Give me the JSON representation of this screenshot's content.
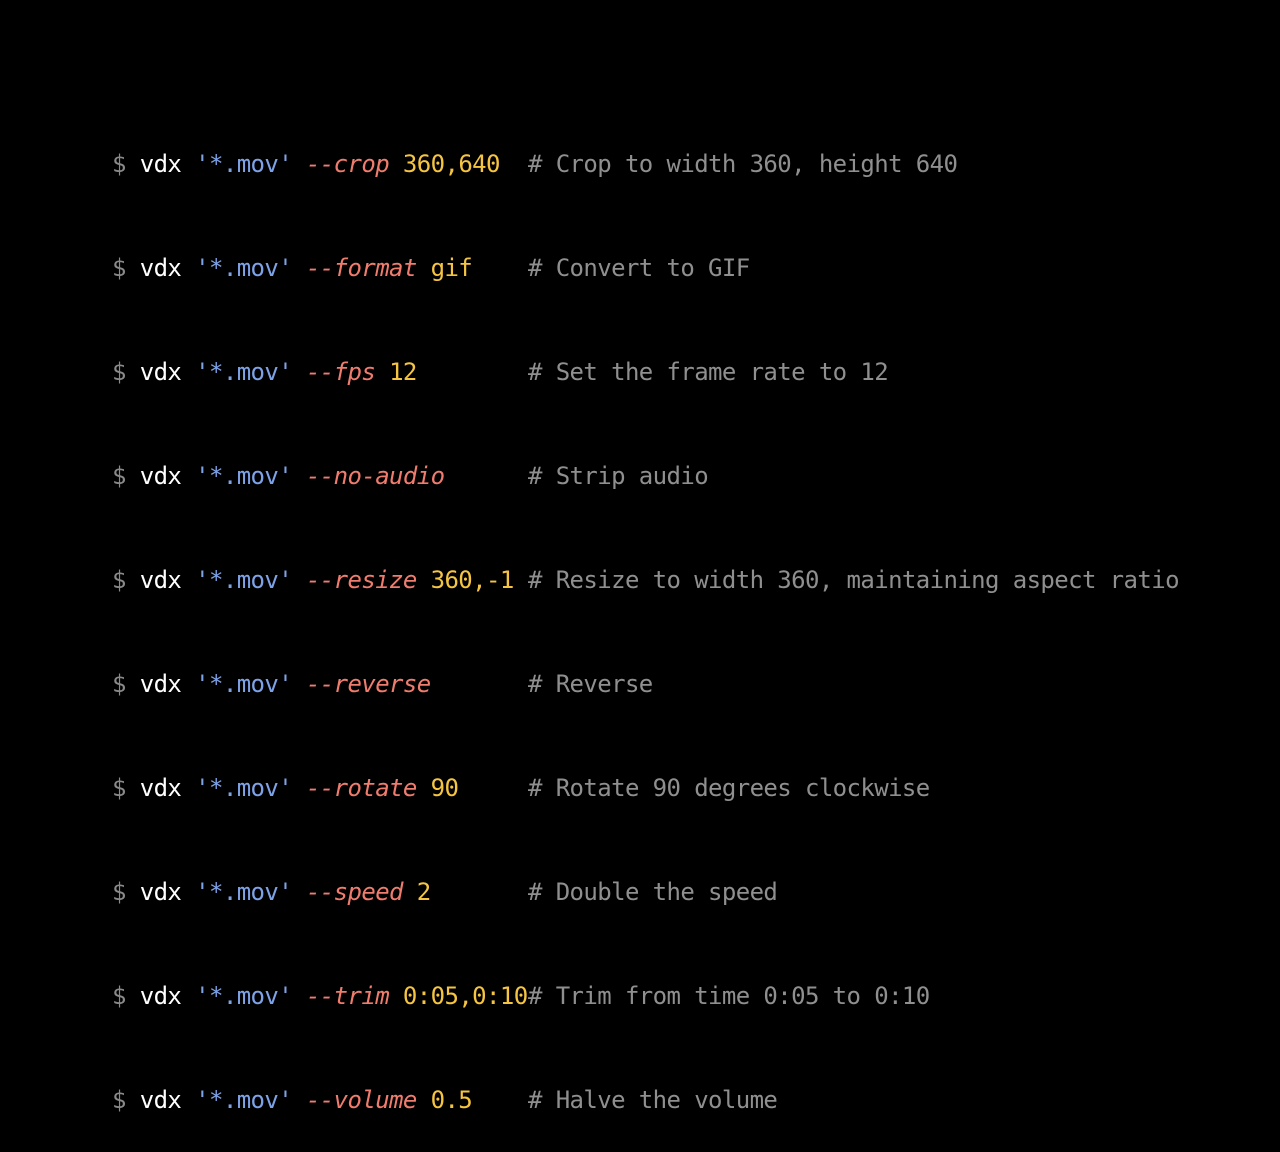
{
  "prompt_symbol": "$",
  "command": "vdx",
  "glob": "'*.mov'",
  "lines": [
    {
      "flag": "--crop",
      "arg": "360,640",
      "comment": "# Crop to width 360, height 640"
    },
    {
      "flag": "--format",
      "arg": "gif",
      "comment": "# Convert to GIF"
    },
    {
      "flag": "--fps",
      "arg": "12",
      "comment": "# Set the frame rate to 12"
    },
    {
      "flag": "--no-audio",
      "arg": "",
      "comment": "# Strip audio"
    },
    {
      "flag": "--resize",
      "arg": "360,-1",
      "comment": "# Resize to width 360, maintaining aspect ratio"
    },
    {
      "flag": "--reverse",
      "arg": "",
      "comment": "# Reverse"
    },
    {
      "flag": "--rotate",
      "arg": "90",
      "comment": "# Rotate 90 degrees clockwise"
    },
    {
      "flag": "--speed",
      "arg": "2",
      "comment": "# Double the speed"
    },
    {
      "flag": "--trim",
      "arg": "0:05,0:10",
      "comment": "# Trim from time 0:05 to 0:10"
    },
    {
      "flag": "--volume",
      "arg": "0.5",
      "comment": "# Halve the volume"
    }
  ]
}
